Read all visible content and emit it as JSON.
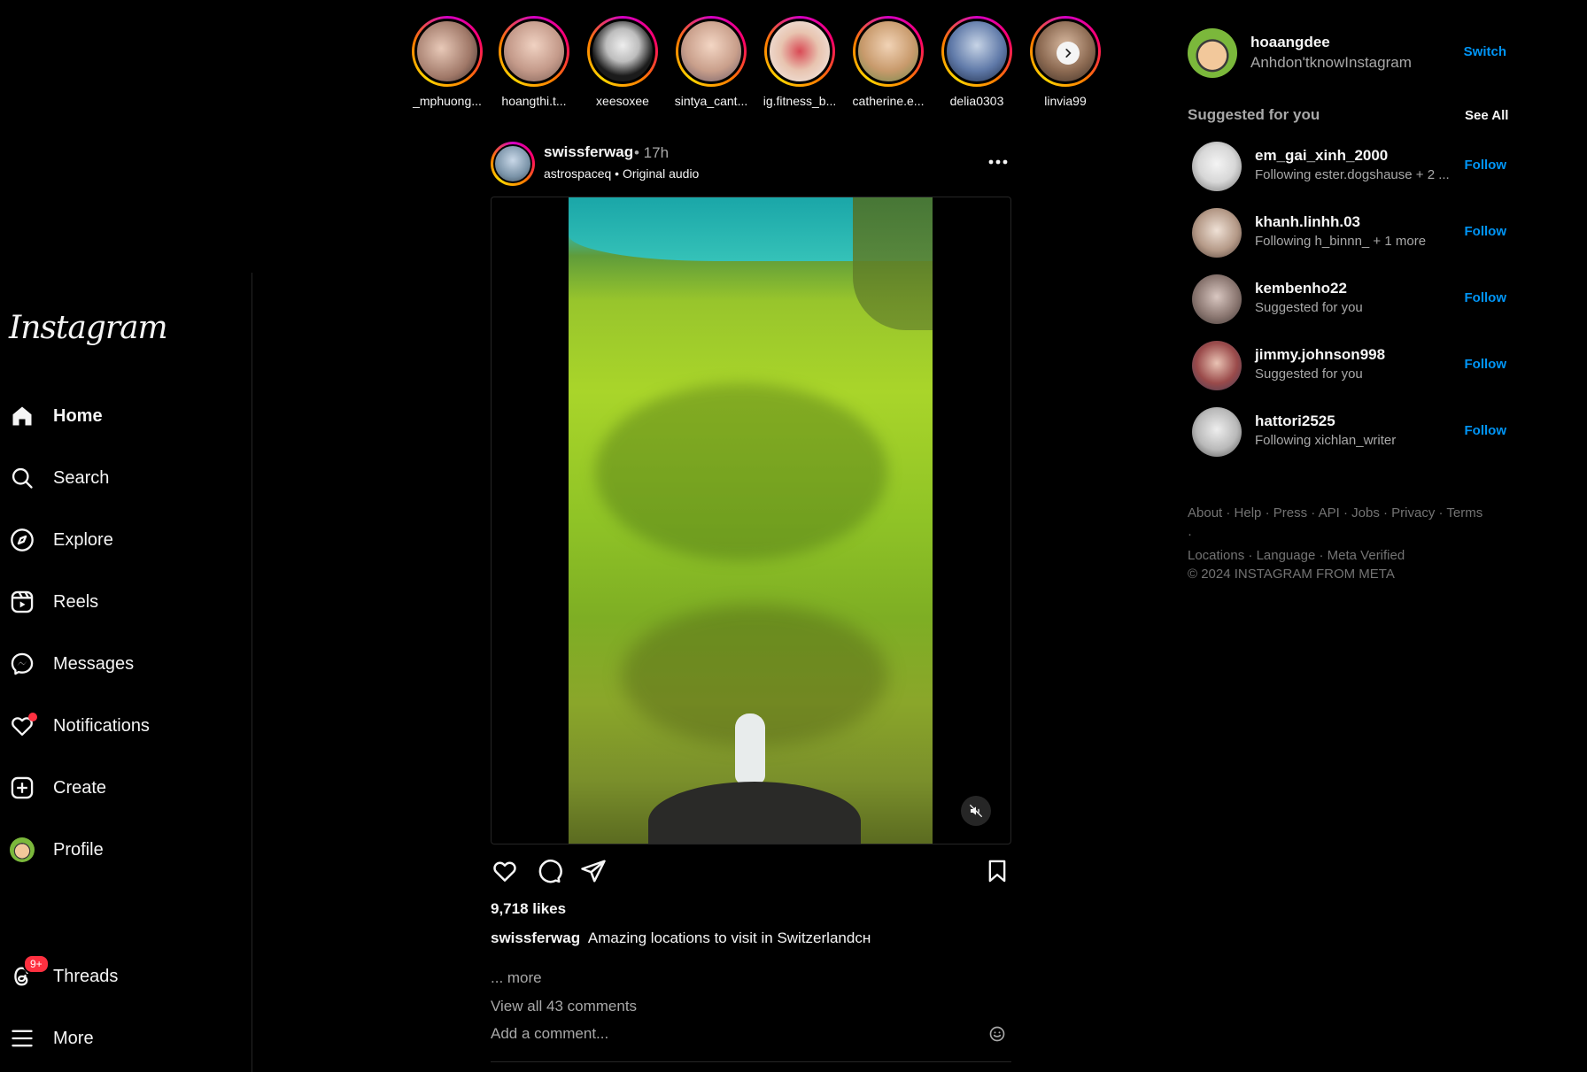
{
  "sidebar": {
    "logo": "Instagram",
    "items": [
      {
        "label": "Home",
        "icon": "home-icon",
        "active": true
      },
      {
        "label": "Search",
        "icon": "search-icon"
      },
      {
        "label": "Explore",
        "icon": "compass-icon"
      },
      {
        "label": "Reels",
        "icon": "reels-icon"
      },
      {
        "label": "Messages",
        "icon": "messenger-icon"
      },
      {
        "label": "Notifications",
        "icon": "heart-icon"
      },
      {
        "label": "Create",
        "icon": "plus-square-icon"
      },
      {
        "label": "Profile",
        "icon": "avatar"
      }
    ],
    "bottom": [
      {
        "label": "Threads",
        "icon": "threads-icon",
        "badge": "9+"
      },
      {
        "label": "More",
        "icon": "menu-icon"
      }
    ]
  },
  "stories": [
    {
      "name": "_mphuong..."
    },
    {
      "name": "hoangthi.t..."
    },
    {
      "name": "xeesoxee"
    },
    {
      "name": "sintya_cant..."
    },
    {
      "name": "ig.fitness_b..."
    },
    {
      "name": "catherine.e..."
    },
    {
      "name": "delia0303"
    },
    {
      "name": "linvia99"
    }
  ],
  "post": {
    "username": "swissferwag",
    "time": "• 17h",
    "audio": "astrospaceq • Original audio",
    "likes": "9,718 likes",
    "caption_user": "swissferwag",
    "caption_text": "Amazing locations to visit in Switzerlandᴄʜ",
    "more": "... more",
    "view_comments": "View all 43 comments",
    "comment_placeholder": "Add a comment..."
  },
  "right": {
    "me": {
      "username": "hoaangdee",
      "name": "Anhdon'tknowInstagram",
      "switch": "Switch"
    },
    "suggested_title": "Suggested for you",
    "see_all": "See All",
    "suggestions": [
      {
        "username": "em_gai_xinh_2000",
        "sub": "Following ester.dogshause + 2 ...",
        "action": "Follow"
      },
      {
        "username": "khanh.linhh.03",
        "sub": "Following h_binnn_ + 1 more",
        "action": "Follow"
      },
      {
        "username": "kembenho22",
        "sub": "Suggested for you",
        "action": "Follow"
      },
      {
        "username": "jimmy.johnson998",
        "sub": "Suggested for you",
        "action": "Follow"
      },
      {
        "username": "hattori2525",
        "sub": "Following xichlan_writer",
        "action": "Follow"
      }
    ],
    "footer_links": [
      "About",
      "Help",
      "Press",
      "API",
      "Jobs",
      "Privacy",
      "Terms",
      "Locations",
      "Language",
      "Meta Verified"
    ],
    "copyright": "© 2024 INSTAGRAM FROM META"
  },
  "colors": {
    "accent": "#0095f6",
    "badge": "#ff3040",
    "muted": "#a8a8a8",
    "bg": "#000000"
  }
}
